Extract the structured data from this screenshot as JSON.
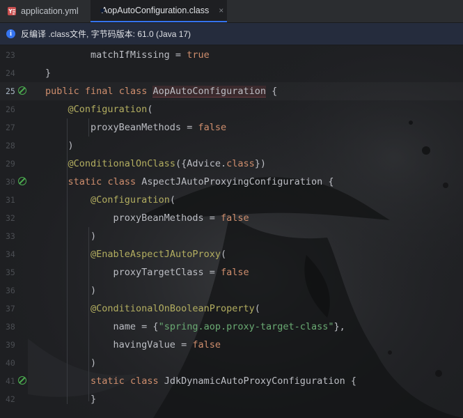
{
  "tabs": [
    {
      "label": "application.yml",
      "icon": "yaml-file-icon"
    },
    {
      "label": "AopAutoConfiguration.class",
      "icon": "class-file-icon",
      "close": "×"
    }
  ],
  "infobar": {
    "text": "反编译 .class文件, 字节码版本: 61.0 (Java 17)",
    "icon": "i"
  },
  "lines": [
    {
      "n": "23",
      "t": "        matchIfMissing = true"
    },
    {
      "n": "24",
      "t": "}"
    },
    {
      "n": "25",
      "t": "public final class AopAutoConfiguration {"
    },
    {
      "n": "26",
      "t": "    @Configuration("
    },
    {
      "n": "27",
      "t": "        proxyBeanMethods = false"
    },
    {
      "n": "28",
      "t": "    )"
    },
    {
      "n": "29",
      "t": "    @ConditionalOnClass({Advice.class})"
    },
    {
      "n": "30",
      "t": "    static class AspectJAutoProxyingConfiguration {"
    },
    {
      "n": "31",
      "t": "        @Configuration("
    },
    {
      "n": "32",
      "t": "            proxyBeanMethods = false"
    },
    {
      "n": "33",
      "t": "        )"
    },
    {
      "n": "34",
      "t": "        @EnableAspectJAutoProxy("
    },
    {
      "n": "35",
      "t": "            proxyTargetClass = false"
    },
    {
      "n": "36",
      "t": "        )"
    },
    {
      "n": "37",
      "t": "        @ConditionalOnBooleanProperty("
    },
    {
      "n": "38",
      "t": "            name = {\"spring.aop.proxy-target-class\"},"
    },
    {
      "n": "39",
      "t": "            havingValue = false"
    },
    {
      "n": "40",
      "t": "        )"
    },
    {
      "n": "41",
      "t": "        static class JdkDynamicAutoProxyConfiguration {"
    },
    {
      "n": "42",
      "t": "        }"
    }
  ],
  "colors": {
    "keyword": "#cf8e6d",
    "annotation": "#b3ae60",
    "string": "#6aab73",
    "text": "#bcbec4",
    "bean_gutter": "#4caf50"
  }
}
